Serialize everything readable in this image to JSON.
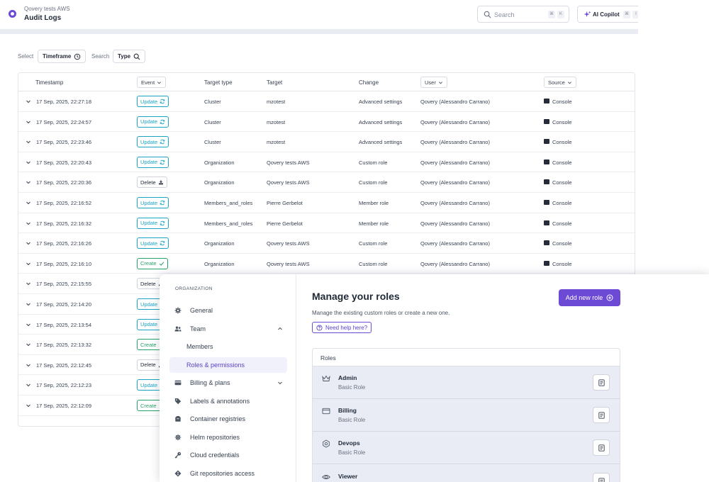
{
  "header": {
    "org_name": "Qovery tests AWS",
    "title": "Audit Logs",
    "search_placeholder": "Search",
    "search_kbd": [
      "⌘",
      "K"
    ],
    "copilot_label": "AI Copilot",
    "copilot_kbd": [
      "⌘",
      "I"
    ]
  },
  "filters": {
    "select_label": "Select",
    "timeframe_label": "Timeframe",
    "search_label": "Search",
    "type_label": "Type"
  },
  "table": {
    "columns": {
      "timestamp": "Timestamp",
      "event": "Event",
      "target_type": "Target type",
      "target": "Target",
      "change": "Change",
      "user": "User",
      "source": "Source"
    },
    "rows": [
      {
        "timestamp": "17 Sep, 2025, 22:27:18",
        "event": "Update",
        "kind": "update",
        "target_type": "Cluster",
        "target": "mzotest",
        "change": "Advanced settings",
        "user": "Qovery (Alessandro Carrano)",
        "source": "Console"
      },
      {
        "timestamp": "17 Sep, 2025, 22:24:57",
        "event": "Update",
        "kind": "update",
        "target_type": "Cluster",
        "target": "mzotest",
        "change": "Advanced settings",
        "user": "Qovery (Alessandro Carrano)",
        "source": "Console"
      },
      {
        "timestamp": "17 Sep, 2025, 22:23:46",
        "event": "Update",
        "kind": "update",
        "target_type": "Cluster",
        "target": "mzotest",
        "change": "Advanced settings",
        "user": "Qovery (Alessandro Carrano)",
        "source": "Console"
      },
      {
        "timestamp": "17 Sep, 2025, 22:20:43",
        "event": "Update",
        "kind": "update",
        "target_type": "Organization",
        "target": "Qovery tests AWS",
        "change": "Custom role",
        "user": "Qovery (Alessandro Carrano)",
        "source": "Console"
      },
      {
        "timestamp": "17 Sep, 2025, 22:20:36",
        "event": "Delete",
        "kind": "delete",
        "target_type": "Organization",
        "target": "Qovery tests AWS",
        "change": "Custom role",
        "user": "Qovery (Alessandro Carrano)",
        "source": "Console"
      },
      {
        "timestamp": "17 Sep, 2025, 22:16:52",
        "event": "Update",
        "kind": "update",
        "target_type": "Members_and_roles",
        "target": "Pierre Gerbelot",
        "change": "Member role",
        "user": "Qovery (Alessandro Carrano)",
        "source": "Console"
      },
      {
        "timestamp": "17 Sep, 2025, 22:16:32",
        "event": "Update",
        "kind": "update",
        "target_type": "Members_and_roles",
        "target": "Pierre Gerbelot",
        "change": "Member role",
        "user": "Qovery (Alessandro Carrano)",
        "source": "Console"
      },
      {
        "timestamp": "17 Sep, 2025, 22:16:26",
        "event": "Update",
        "kind": "update",
        "target_type": "Organization",
        "target": "Qovery tests AWS",
        "change": "Custom role",
        "user": "Qovery (Alessandro Carrano)",
        "source": "Console"
      },
      {
        "timestamp": "17 Sep, 2025, 22:16:10",
        "event": "Create",
        "kind": "create",
        "target_type": "Organization",
        "target": "Qovery tests AWS",
        "change": "Custom role",
        "user": "Qovery (Alessandro Carrano)",
        "source": "Console"
      },
      {
        "timestamp": "17 Sep, 2025, 22:15:55",
        "event": "Delete",
        "kind": "delete",
        "target_type": "",
        "target": "",
        "change": "",
        "user": "",
        "source": ""
      },
      {
        "timestamp": "17 Sep, 2025, 22:14:20",
        "event": "Update",
        "kind": "update",
        "target_type": "",
        "target": "",
        "change": "",
        "user": "",
        "source": ""
      },
      {
        "timestamp": "17 Sep, 2025, 22:13:54",
        "event": "Update",
        "kind": "update",
        "target_type": "",
        "target": "",
        "change": "",
        "user": "",
        "source": ""
      },
      {
        "timestamp": "17 Sep, 2025, 22:13:32",
        "event": "Create",
        "kind": "create",
        "target_type": "",
        "target": "",
        "change": "",
        "user": "",
        "source": ""
      },
      {
        "timestamp": "17 Sep, 2025, 22:12:45",
        "event": "Delete",
        "kind": "delete",
        "target_type": "",
        "target": "",
        "change": "",
        "user": "",
        "source": ""
      },
      {
        "timestamp": "17 Sep, 2025, 22:12:23",
        "event": "Update",
        "kind": "update",
        "target_type": "",
        "target": "",
        "change": "",
        "user": "",
        "source": ""
      },
      {
        "timestamp": "17 Sep, 2025, 22:12:09",
        "event": "Create",
        "kind": "create",
        "target_type": "",
        "target": "",
        "change": "",
        "user": "",
        "source": ""
      }
    ]
  },
  "settings": {
    "sidebar_heading": "ORGANIZATION",
    "nav": [
      {
        "label": "General",
        "icon": "gear-icon",
        "level": 0
      },
      {
        "label": "Team",
        "icon": "users-icon",
        "level": 0,
        "expanded": true
      },
      {
        "label": "Members",
        "icon": "",
        "level": 1
      },
      {
        "label": "Roles & permissions",
        "icon": "",
        "level": 1,
        "active": true
      },
      {
        "label": "Billing & plans",
        "icon": "credit-card-icon",
        "level": 0,
        "expanded": false
      },
      {
        "label": "Labels & annotations",
        "icon": "tag-icon",
        "level": 0
      },
      {
        "label": "Container registries",
        "icon": "box-icon",
        "level": 0
      },
      {
        "label": "Helm repositories",
        "icon": "helm-icon",
        "level": 0
      },
      {
        "label": "Cloud credentials",
        "icon": "key-icon",
        "level": 0
      },
      {
        "label": "Git repositories access",
        "icon": "git-icon",
        "level": 0
      }
    ],
    "title": "Manage your roles",
    "description": "Manage the existing custom roles or create a new one.",
    "help_label": "Need help here?",
    "add_button_label": "Add new role",
    "roles_header": "Roles",
    "roles": [
      {
        "name": "Admin",
        "type": "Basic Role",
        "icon": "crown-icon"
      },
      {
        "name": "Billing",
        "type": "Basic Role",
        "icon": "credit-card-icon"
      },
      {
        "name": "Devops",
        "type": "Basic Role",
        "icon": "gear-icon"
      },
      {
        "name": "Viewer",
        "type": "",
        "icon": "eye-icon"
      }
    ]
  },
  "colors": {
    "accent": "#6d4ad6",
    "update": "#1aa3c2",
    "create": "#25a26a"
  }
}
